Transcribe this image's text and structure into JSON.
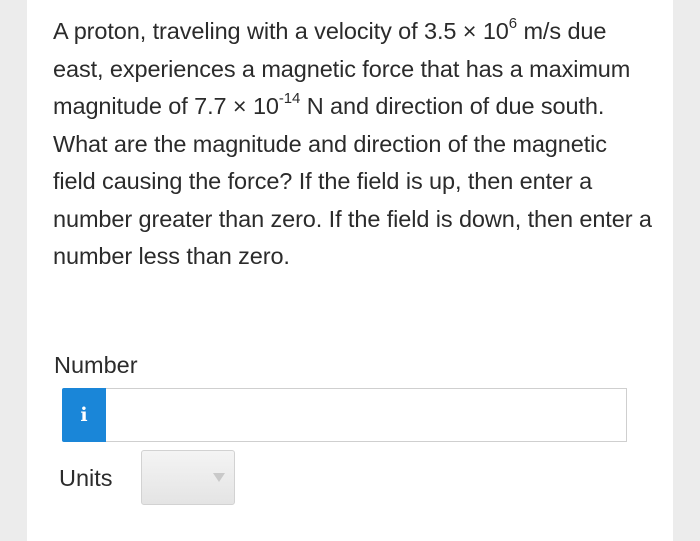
{
  "question": {
    "part1": "A proton, traveling with a velocity of 3.5 × 10",
    "exp1": "6",
    "part2": " m/s due east, experiences a magnetic force that has a maximum magnitude of 7.7 × 10",
    "exp2": "-14",
    "part3": " N and direction of due south. What are the magnitude and direction of the magnetic field causing the force? If the field is up, then enter a number greater than zero. If the field is down, then enter a number less than zero."
  },
  "number": {
    "label": "Number",
    "info_glyph": "i",
    "value": ""
  },
  "units": {
    "label": "Units",
    "selected": ""
  },
  "colors": {
    "accent": "#1a86d8",
    "text": "#2b2b2b",
    "background": "#ececec"
  }
}
